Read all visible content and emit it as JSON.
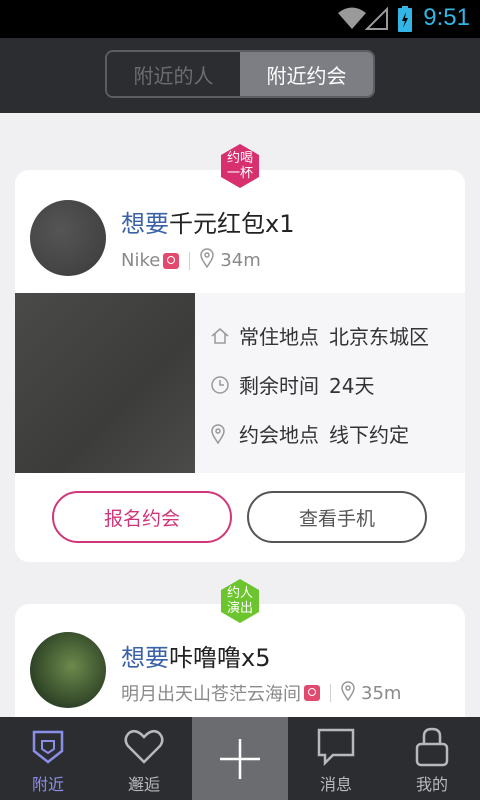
{
  "status_bar": {
    "time": "9:51"
  },
  "header": {
    "tabs": [
      {
        "label": "附近的人",
        "active": false
      },
      {
        "label": "附近约会",
        "active": true
      }
    ]
  },
  "posts": [
    {
      "badge": "约喝\n一杯",
      "badge_color": "#d82f6e",
      "want_prefix": "想要",
      "want_item": "千元红包x1",
      "user": "Nike",
      "distance": "34m",
      "details": [
        {
          "label": "常住地点",
          "value": "北京东城区"
        },
        {
          "label": "剩余时间",
          "value": "24天"
        },
        {
          "label": "约会地点",
          "value": "线下约定"
        }
      ],
      "buttons": {
        "signup": "报名约会",
        "phone": "查看手机"
      }
    },
    {
      "badge": "约人\n演出",
      "badge_color": "#6cc52e",
      "want_prefix": "想要",
      "want_item": "咔噜噜x5",
      "user": "明月出天山苍茫云海间",
      "distance": "35m"
    }
  ],
  "nav": {
    "items": [
      {
        "label": "附近",
        "icon": "shield-icon",
        "active": true
      },
      {
        "label": "邂逅",
        "icon": "heart-icon",
        "active": false
      },
      {
        "label": "",
        "icon": "plus-icon",
        "active": false
      },
      {
        "label": "消息",
        "icon": "chat-bubble-icon",
        "active": false
      },
      {
        "label": "我的",
        "icon": "person-icon",
        "active": false
      }
    ]
  },
  "colors": {
    "accent_blue": "#3a62a8",
    "accent_pink": "#d0377a",
    "nav_active": "#8b8ee6",
    "status_time": "#33b5e5"
  }
}
